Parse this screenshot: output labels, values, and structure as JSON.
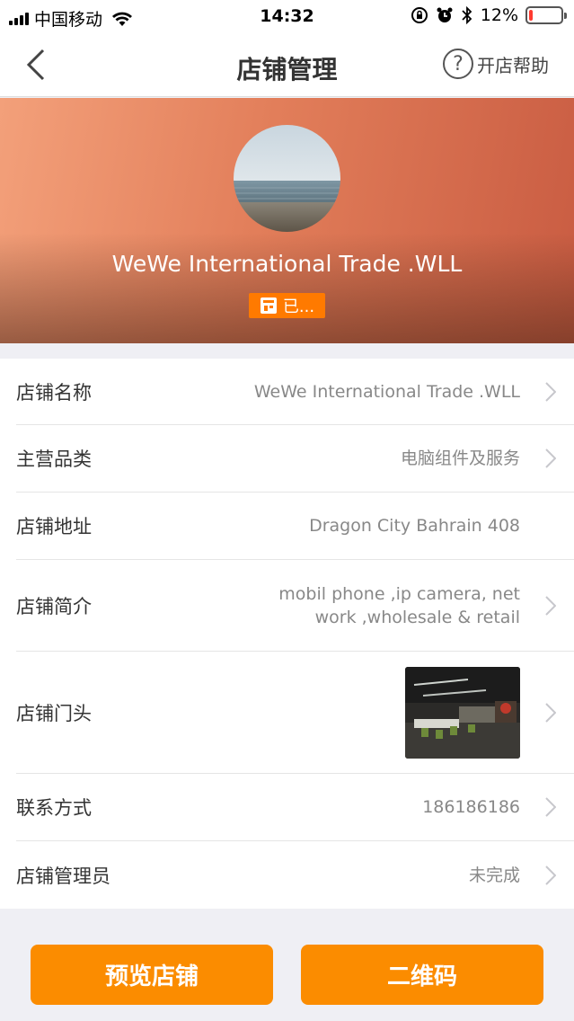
{
  "status_bar": {
    "carrier": "中国移动",
    "time": "14:32",
    "battery": "12%",
    "battery_level": 0.12
  },
  "nav": {
    "title": "店铺管理",
    "help_label": "开店帮助",
    "help_icon": "?"
  },
  "header": {
    "shop_name": "WeWe  International Trade .WLL",
    "status_label": "已..."
  },
  "rows": [
    {
      "label": "店铺名称",
      "value": "WeWe  International Trade .WLL"
    },
    {
      "label": "主营品类",
      "value": "电脑组件及服务"
    },
    {
      "label": "店铺地址",
      "value": "Dragon City Bahrain 408"
    },
    {
      "label": "店铺简介",
      "value_line1": "mobil phone ,ip camera, net",
      "value_line2": "work ,wholesale & retail"
    },
    {
      "label": "店铺门头"
    },
    {
      "label": "联系方式",
      "value": "186186186"
    },
    {
      "label": "店铺管理员",
      "value": "未完成"
    }
  ],
  "buttons": {
    "preview": "预览店铺",
    "qrcode": "二维码"
  },
  "colors": {
    "accent": "#fb8c00",
    "tag": "#ff7a00"
  }
}
